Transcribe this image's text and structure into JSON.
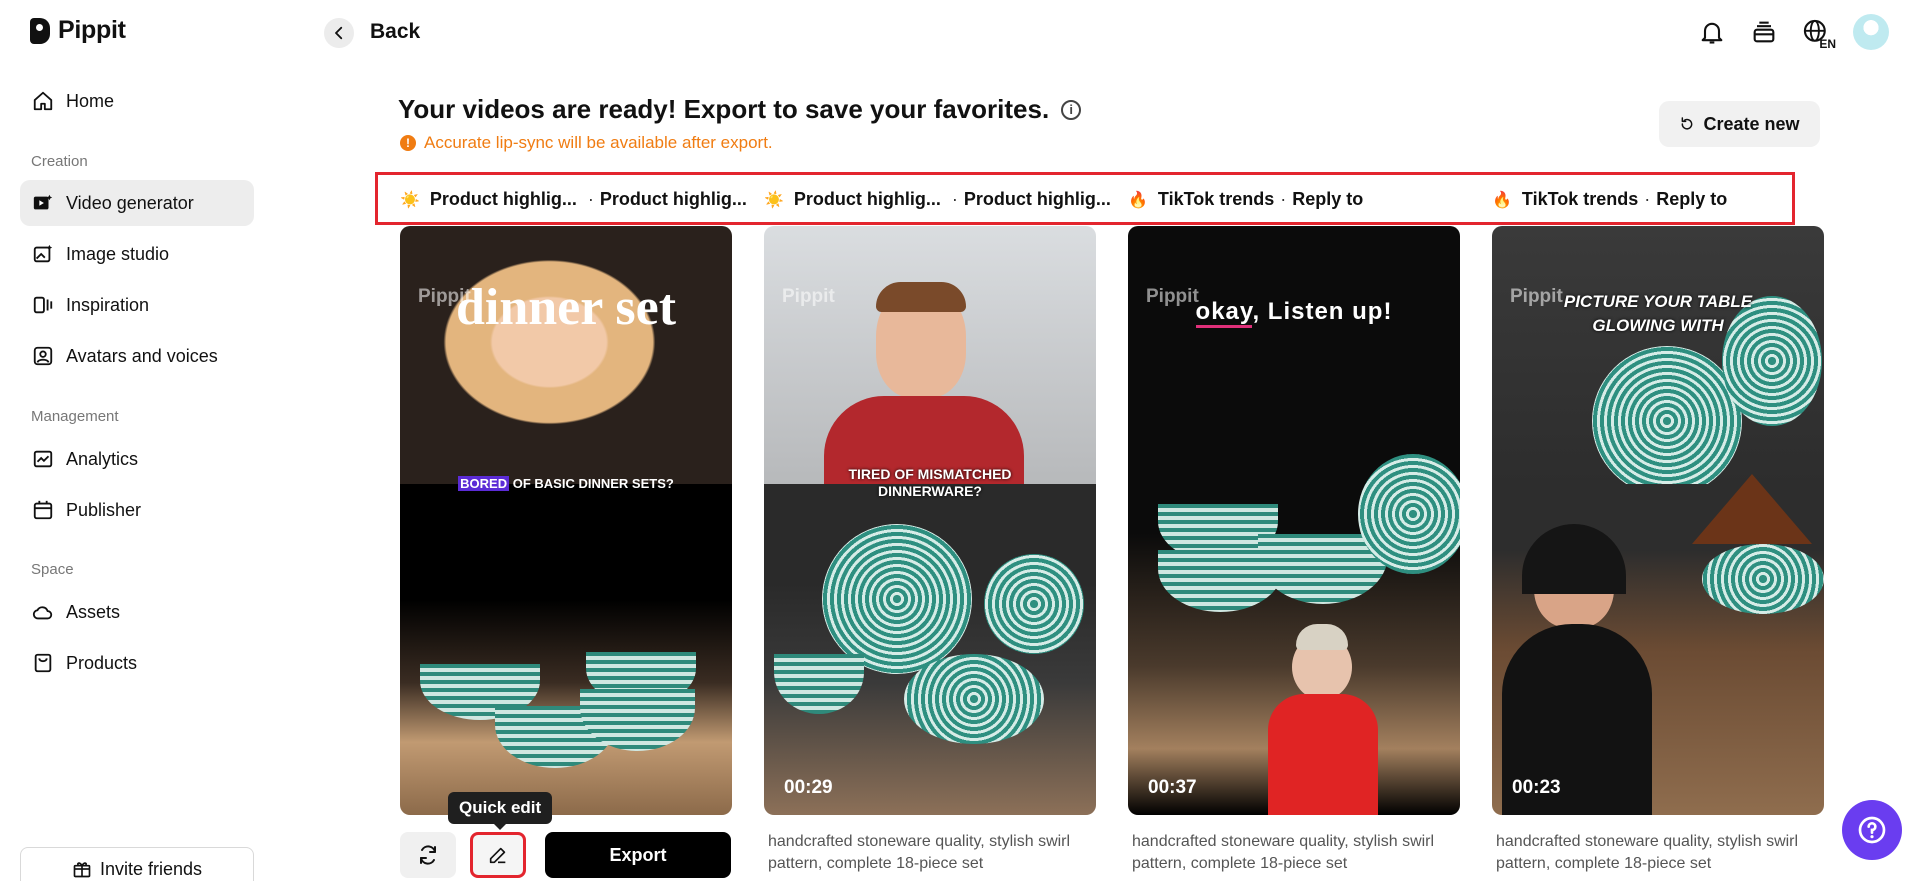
{
  "app": {
    "name": "Pippit"
  },
  "sidebar": {
    "home": "Home",
    "sections": {
      "creation": "Creation",
      "management": "Management",
      "space": "Space"
    },
    "items": {
      "video_generator": "Video generator",
      "image_studio": "Image studio",
      "inspiration": "Inspiration",
      "avatars_voices": "Avatars and voices",
      "analytics": "Analytics",
      "publisher": "Publisher",
      "assets": "Assets",
      "products": "Products"
    },
    "invite": "Invite friends"
  },
  "topbar": {
    "back": "Back",
    "language": "EN"
  },
  "header": {
    "title": "Your videos are ready! Export to save your favorites.",
    "notice": "Accurate lip-sync will be available after export.",
    "create_new": "Create new"
  },
  "tags": [
    {
      "emoji": "☀️",
      "a": "Product highlig...",
      "b": "Product highlig..."
    },
    {
      "emoji": "☀️",
      "a": "Product highlig...",
      "b": "Product highlig..."
    },
    {
      "emoji": "🔥",
      "a": "TikTok trends",
      "b": "Reply to"
    },
    {
      "emoji": "🔥",
      "a": "TikTok trends",
      "b": "Reply to"
    }
  ],
  "videos": [
    {
      "watermark": "Pippit",
      "title_overlay": "dinner set",
      "caption_highlight": "BORED",
      "caption_rest": " OF BASIC DINNER SETS?",
      "duration": ""
    },
    {
      "watermark": "Pippit",
      "caption": "TIRED OF MISMATCHED DINNERWARE?",
      "duration": "00:29",
      "description": "handcrafted stoneware quality, stylish swirl pattern, complete 18-piece set"
    },
    {
      "watermark": "Pippit",
      "caption_highlight": "okay",
      "caption_rest": ", Listen up!",
      "duration": "00:37",
      "description": "handcrafted stoneware quality, stylish swirl pattern, complete 18-piece set"
    },
    {
      "watermark": "Pippit",
      "caption": "PICTURE YOUR TABLE GLOWING WITH",
      "duration": "00:23",
      "description": "handcrafted stoneware quality, stylish swirl pattern, complete 18-piece set"
    }
  ],
  "card_actions": {
    "tooltip": "Quick edit",
    "export": "Export"
  }
}
